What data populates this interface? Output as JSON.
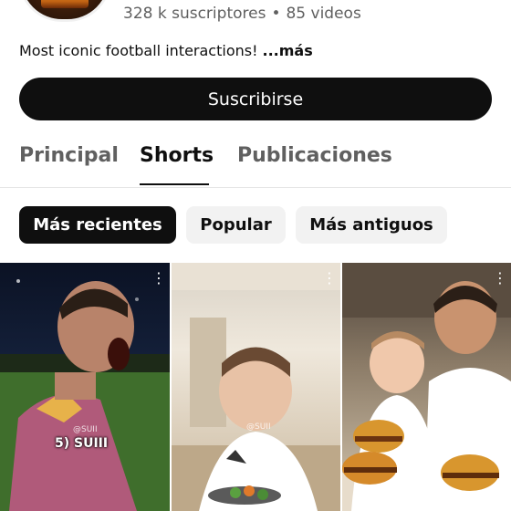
{
  "channel": {
    "subscribers": "328 k suscriptores",
    "separator": "•",
    "videos": "85 videos",
    "description": "Most iconic football interactions!",
    "more_label": "...más",
    "subscribe_label": "Suscribirse"
  },
  "tabs": [
    {
      "label": "Principal",
      "active": false
    },
    {
      "label": "Shorts",
      "active": true
    },
    {
      "label": "Publicaciones",
      "active": false
    }
  ],
  "filters": [
    {
      "label": "Más recientes",
      "selected": true
    },
    {
      "label": "Popular",
      "selected": false
    },
    {
      "label": "Más antiguos",
      "selected": false
    }
  ],
  "shorts": [
    {
      "caption": "5) SUIII",
      "overlay_tag": "@SUII",
      "menu_icon": "more-vert-icon"
    },
    {
      "caption": "",
      "overlay_tag": "@SUII",
      "menu_icon": "more-vert-icon"
    },
    {
      "caption": "",
      "overlay_tag": "",
      "menu_icon": "more-vert-icon"
    }
  ],
  "colors": {
    "primary_text": "#0f0f0f",
    "secondary_text": "#606060",
    "chip_bg": "#f2f2f2",
    "subscribe_bg": "#0f0f0f"
  }
}
